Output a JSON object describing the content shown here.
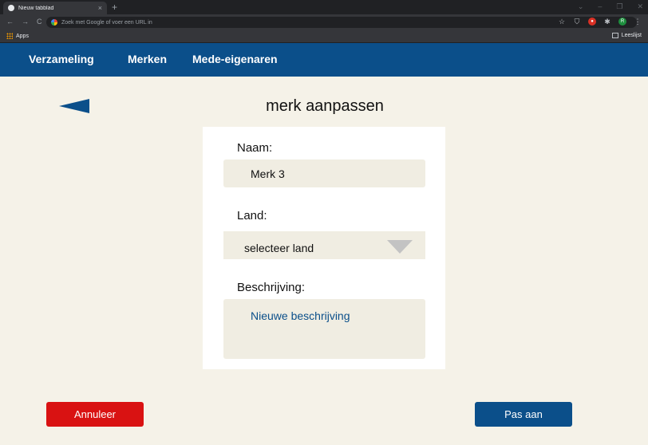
{
  "browser": {
    "tab_title": "Nieuw tabblad",
    "tab_close": "×",
    "new_tab": "+",
    "omnibox_placeholder": "Zoek met Google of voer een URL in",
    "bookmarks_apps": "Apps",
    "reading_list": "Leeslijst",
    "profile_initial": "R",
    "icons": [
      "back-icon",
      "forward-icon",
      "reload-icon",
      "star-icon",
      "shield-icon",
      "extension-icon",
      "puzzle-icon",
      "menu-icon"
    ]
  },
  "nav": {
    "items": [
      {
        "label": "Verzameling"
      },
      {
        "label": "Merken"
      },
      {
        "label": "Mede-eigenaren"
      }
    ]
  },
  "page": {
    "title": "merk aanpassen",
    "back_icon": "back-arrow-icon"
  },
  "form": {
    "name_label": "Naam:",
    "name_value": "Merk 3",
    "country_label": "Land:",
    "country_value": "selecteer land",
    "description_label": "Beschrijving:",
    "description_value": "Nieuwe beschrijving"
  },
  "actions": {
    "cancel_label": "Annuleer",
    "save_label": "Pas aan"
  },
  "colors": {
    "nav_bg": "#0b4f8a",
    "page_bg": "#f5f2e8",
    "cancel": "#d91212",
    "save": "#0b4f8a"
  }
}
